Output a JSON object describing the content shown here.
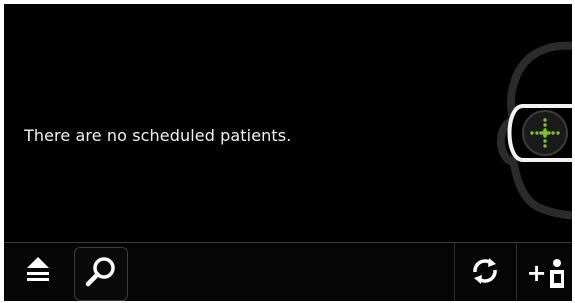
{
  "main": {
    "empty_message": "There are no scheduled patients."
  },
  "illustration": {
    "icon": "head-with-vr-goggles-icon",
    "accent_color": "#7cc22c"
  },
  "toolbar": {
    "buttons": [
      {
        "icon": "eject-menu-icon"
      },
      {
        "icon": "search-icon"
      },
      {
        "icon": "refresh-icon"
      },
      {
        "icon": "add-patient-icon",
        "label": "+"
      }
    ]
  }
}
